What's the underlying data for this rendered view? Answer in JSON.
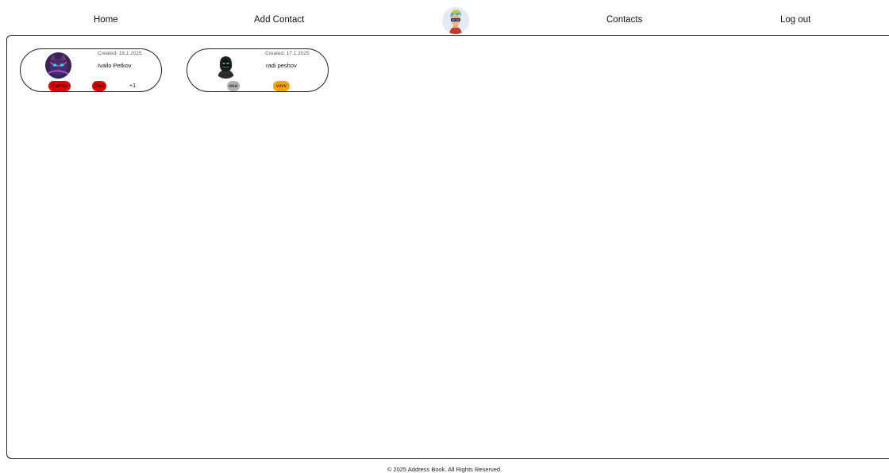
{
  "nav": {
    "home": "Home",
    "add_contact": "Add Contact",
    "contacts": "Contacts",
    "logout": "Log out",
    "avatar_icon": "user-avatar-icon"
  },
  "contacts": [
    {
      "created": "Created: 18.1.2025",
      "name": "Ivailo Petkov",
      "avatar_icon": "cat-avatar-icon",
      "tags": [
        {
          "label": "Family",
          "color": "#e00000"
        },
        {
          "label": "Dad",
          "color": "#e00000"
        }
      ],
      "more": "+1"
    },
    {
      "created": "Created: 17.1.2025",
      "name": "radi peshov",
      "avatar_icon": "hooded-figure-avatar-icon",
      "tags": [
        {
          "label": "eee",
          "color": "#b0b0b0"
        },
        {
          "label": "vvvv",
          "color": "#f5a300"
        }
      ]
    }
  ],
  "footer": {
    "text": "© 2025 Address Book. All Rights Reserved."
  }
}
